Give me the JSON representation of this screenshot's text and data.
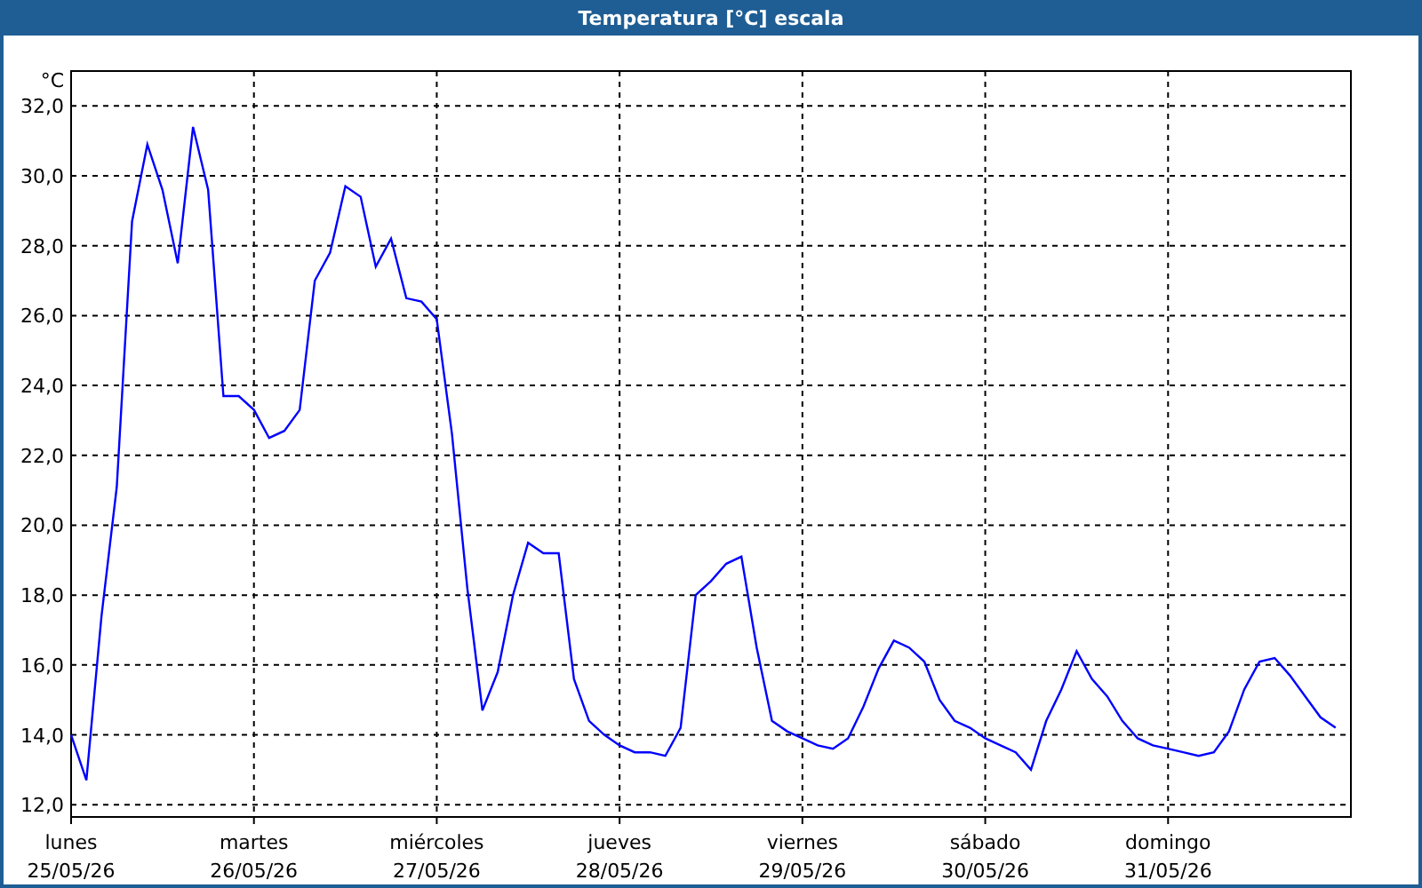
{
  "window": {
    "title": "Temperatura [°C] escala"
  },
  "chart": {
    "chart_data": {
      "type": "line",
      "ylabel": "°C",
      "grid": true,
      "categories": [
        "25/05/26",
        null,
        null,
        null,
        null,
        null,
        null,
        null,
        null,
        null,
        null,
        null,
        "26/05/26",
        null,
        null,
        null,
        null,
        null,
        null,
        null,
        null,
        null,
        null,
        null,
        "27/05/26",
        null,
        null,
        null,
        null,
        null,
        null,
        null,
        null,
        null,
        null,
        null,
        "28/05/26",
        null,
        null,
        null,
        null,
        null,
        null,
        null,
        null,
        null,
        null,
        null,
        "29/05/26",
        null,
        null,
        null,
        null,
        null,
        null,
        null,
        null,
        null,
        null,
        null,
        "30/05/26",
        null,
        null,
        null,
        null,
        null,
        null,
        null,
        null,
        null,
        null,
        null,
        "31/05/26",
        null,
        null,
        null,
        null,
        null,
        null,
        null,
        null,
        null,
        null,
        null
      ],
      "series": [
        {
          "color": "#0000ff",
          "values": [
            14.0,
            12.7,
            17.4,
            21.1,
            28.7,
            30.9,
            29.6,
            27.5,
            31.4,
            29.6,
            23.7,
            23.7,
            23.3,
            22.5,
            22.7,
            23.3,
            27.0,
            27.8,
            29.7,
            29.4,
            27.4,
            28.2,
            26.5,
            26.4,
            25.9,
            22.6,
            18.2,
            14.7,
            15.8,
            18.0,
            19.5,
            19.2,
            19.2,
            15.6,
            14.4,
            14.0,
            13.7,
            13.5,
            13.5,
            13.4,
            14.2,
            18.0,
            18.4,
            18.9,
            19.1,
            16.5,
            14.4,
            14.1,
            13.9,
            13.7,
            13.6,
            13.9,
            14.8,
            15.9,
            16.7,
            16.5,
            16.1,
            15.0,
            14.4,
            14.2,
            13.9,
            13.7,
            13.5,
            13.0,
            14.4,
            15.3,
            16.4,
            15.6,
            15.1,
            14.4,
            13.9,
            13.7,
            13.6,
            13.5,
            13.4,
            13.5,
            14.1,
            15.3,
            16.1,
            16.2,
            15.7,
            15.1,
            14.5,
            14.2
          ]
        }
      ],
      "ylim": [
        11.65,
        33
      ],
      "yticks": [
        {
          "value": 12,
          "label": "12,0"
        },
        {
          "value": 14,
          "label": "14,0"
        },
        {
          "value": 16,
          "label": "16,0"
        },
        {
          "value": 18,
          "label": "18,0"
        },
        {
          "value": 20,
          "label": "20,0"
        },
        {
          "value": 22,
          "label": "22,0"
        },
        {
          "value": 24,
          "label": "24,0"
        },
        {
          "value": 26,
          "label": "26,0"
        },
        {
          "value": 28,
          "label": "28,0"
        },
        {
          "value": 30,
          "label": "30,0"
        },
        {
          "value": 32,
          "label": "32,0"
        }
      ]
    },
    "day_labels": [
      "lunes",
      "martes",
      "miércoles",
      "jueves",
      "viernes",
      "sábado",
      "domingo"
    ]
  }
}
